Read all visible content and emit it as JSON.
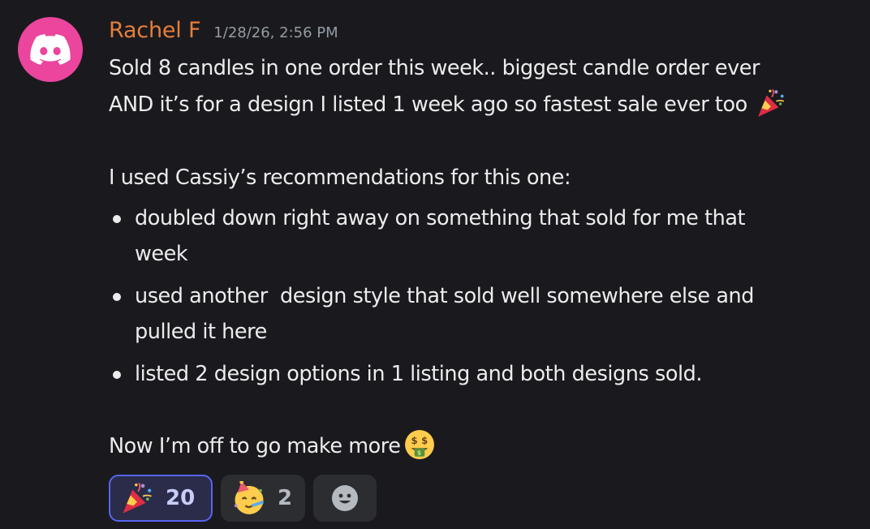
{
  "message": {
    "author": "Rachel F",
    "timestamp": "1/28/26, 2:56 PM",
    "author_color": "#e67e3a",
    "avatar": {
      "icon": "discord-logo-icon",
      "background": "#eb459e"
    },
    "lines": [
      "Sold 8 candles in one order this week.. biggest candle order ever",
      "AND it’s for a design I listed 1 week ago so fastest sale ever too"
    ],
    "inline_emoji": "party-popper-icon",
    "intro": "I used Cassiy’s recommendations for this one:",
    "bullets": [
      "doubled down right away on something that sold for me that week",
      "used another  design style that sold well somewhere else and pulled it here",
      "listed 2 design options in 1 listing and both designs sold."
    ],
    "closing": "Now I’m off to go make more",
    "closing_emoji": "money-mouth-face-icon"
  },
  "reactions": [
    {
      "emoji": "party-popper-icon",
      "count": "20",
      "active": true
    },
    {
      "emoji": "partying-face-icon",
      "count": "2",
      "active": false
    }
  ],
  "add_reaction": {
    "icon": "add-reaction-smiley-icon"
  }
}
